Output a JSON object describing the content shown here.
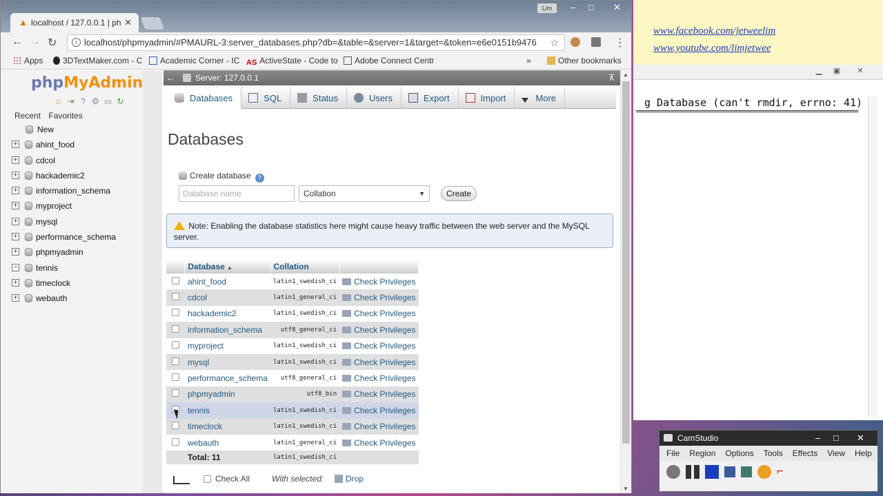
{
  "background": {
    "links": [
      "www.facebook.com/jetweelim",
      "www.youtube.com/limjetwee"
    ],
    "terminal_text": "g Database (can't rmdir, errno: 41)"
  },
  "camstudio": {
    "title": "CamStudio",
    "menu": [
      "File",
      "Region",
      "Options",
      "Tools",
      "Effects",
      "View",
      "Help"
    ]
  },
  "browser": {
    "user_badge": "Lim",
    "tab_title": "localhost / 127.0.0.1 | ph",
    "url": "localhost/phpmyadmin/#PMAURL-3:server_databases.php?db=&table=&server=1&target=&token=e6e0151b9476",
    "bookmarks": [
      "Apps",
      "3DTextMaker.com - C",
      "Academic Corner - IC",
      "ActiveState - Code to",
      "Adobe Connect Centr"
    ],
    "bookmarks_more": "»",
    "other_bookmarks": "Other bookmarks"
  },
  "nav": {
    "logo_php": "php",
    "logo_myadmin": "MyAdmin",
    "tabs": [
      "Recent",
      "Favorites"
    ],
    "new_label": "New",
    "databases": [
      "ahint_food",
      "cdcol",
      "hackademic2",
      "information_schema",
      "myproject",
      "mysql",
      "performance_schema",
      "phpmyadmin",
      "tennis",
      "timeclock",
      "webauth"
    ]
  },
  "server": {
    "label": "Server: 127.0.0.1"
  },
  "menu": [
    "Databases",
    "SQL",
    "Status",
    "Users",
    "Export",
    "Import",
    "More"
  ],
  "page": {
    "title": "Databases",
    "create_label": "Create database",
    "db_name_placeholder": "Database name",
    "collation_value": "Collation",
    "create_button": "Create",
    "notice": "Note: Enabling the database statistics here might cause heavy traffic between the web server and the MySQL server."
  },
  "table": {
    "headers": [
      "Database",
      "Collation"
    ],
    "sort_indicator": "▲",
    "rows": [
      {
        "name": "ahint_food",
        "collation": "latin1_swedish_ci",
        "action": "Check Privileges"
      },
      {
        "name": "cdcol",
        "collation": "latin1_general_ci",
        "action": "Check Privileges"
      },
      {
        "name": "hackademic2",
        "collation": "latin1_swedish_ci",
        "action": "Check Privileges"
      },
      {
        "name": "information_schema",
        "collation": "utf8_general_ci",
        "action": "Check Privileges"
      },
      {
        "name": "myproject",
        "collation": "latin1_swedish_ci",
        "action": "Check Privileges"
      },
      {
        "name": "mysql",
        "collation": "latin1_swedish_ci",
        "action": "Check Privileges"
      },
      {
        "name": "performance_schema",
        "collation": "utf8_general_ci",
        "action": "Check Privileges"
      },
      {
        "name": "phpmyadmin",
        "collation": "utf8_bin",
        "action": "Check Privileges"
      },
      {
        "name": "tennis",
        "collation": "latin1_swedish_ci",
        "action": "Check Privileges"
      },
      {
        "name": "timeclock",
        "collation": "latin1_swedish_ci",
        "action": "Check Privileges"
      },
      {
        "name": "webauth",
        "collation": "latin1_general_ci",
        "action": "Check Privileges"
      }
    ],
    "total_label": "Total: 11",
    "total_collation": "latin1_swedish_ci"
  },
  "footer": {
    "check_all": "Check All",
    "with_selected": "With selected:",
    "drop": "Drop"
  },
  "colors": {
    "link": "#235a81",
    "logo_php": "#6c78af",
    "logo_myadmin": "#f29111"
  }
}
